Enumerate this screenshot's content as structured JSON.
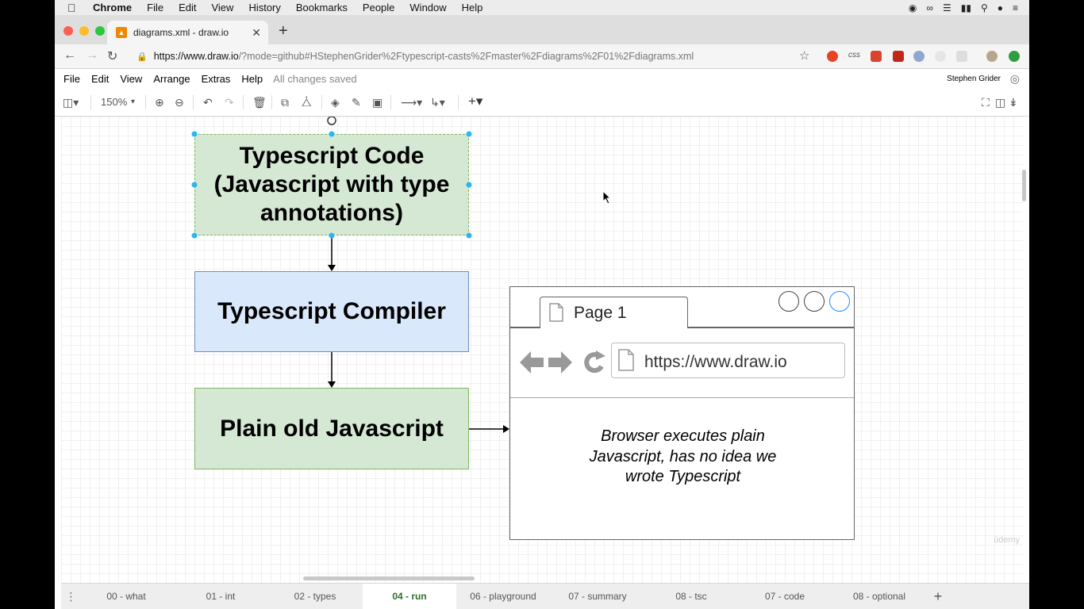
{
  "os_menubar": {
    "app_name": "Chrome",
    "items": [
      "File",
      "Edit",
      "View",
      "History",
      "Bookmarks",
      "People",
      "Window",
      "Help"
    ]
  },
  "browser": {
    "tab_title": "diagrams.xml - draw.io",
    "url_host": "https://www.draw.io",
    "url_rest": "/?mode=github#HStephenGrider%2Ftypescript-casts%2Fmaster%2Fdiagrams%2F01%2Fdiagrams.xml",
    "ext_css_label": "css"
  },
  "app": {
    "menu": [
      "File",
      "Edit",
      "View",
      "Arrange",
      "Extras",
      "Help"
    ],
    "save_status": "All changes saved",
    "user_name": "Stephen Grider",
    "zoom": "150%"
  },
  "diagram": {
    "box1_lines": [
      "Typescript Code",
      "(Javascript with type",
      "annotations)"
    ],
    "box2_label": "Typescript Compiler",
    "box3_label": "Plain old Javascript",
    "mockup": {
      "tab_label": "Page 1",
      "url": "https://www.draw.io",
      "desc_lines": [
        "Browser executes plain",
        "Javascript, has no idea we",
        "wrote Typescript"
      ]
    }
  },
  "page_tabs": [
    {
      "label": "00 - what",
      "active": false
    },
    {
      "label": "01 - int",
      "active": false
    },
    {
      "label": "02 - types",
      "active": false
    },
    {
      "label": "04 - run",
      "active": true
    },
    {
      "label": "06 - playground",
      "active": false
    },
    {
      "label": "07 - summary",
      "active": false
    },
    {
      "label": "08 - tsc",
      "active": false
    },
    {
      "label": "07 - code",
      "active": false
    },
    {
      "label": "08 - optional",
      "active": false
    }
  ],
  "watermark": "ūdemy",
  "colors": {
    "green_fill": "#d5e8d4",
    "blue_fill": "#dae8fc",
    "selection_handle": "#29b6f2",
    "active_tab_text": "#2c6e2c"
  }
}
